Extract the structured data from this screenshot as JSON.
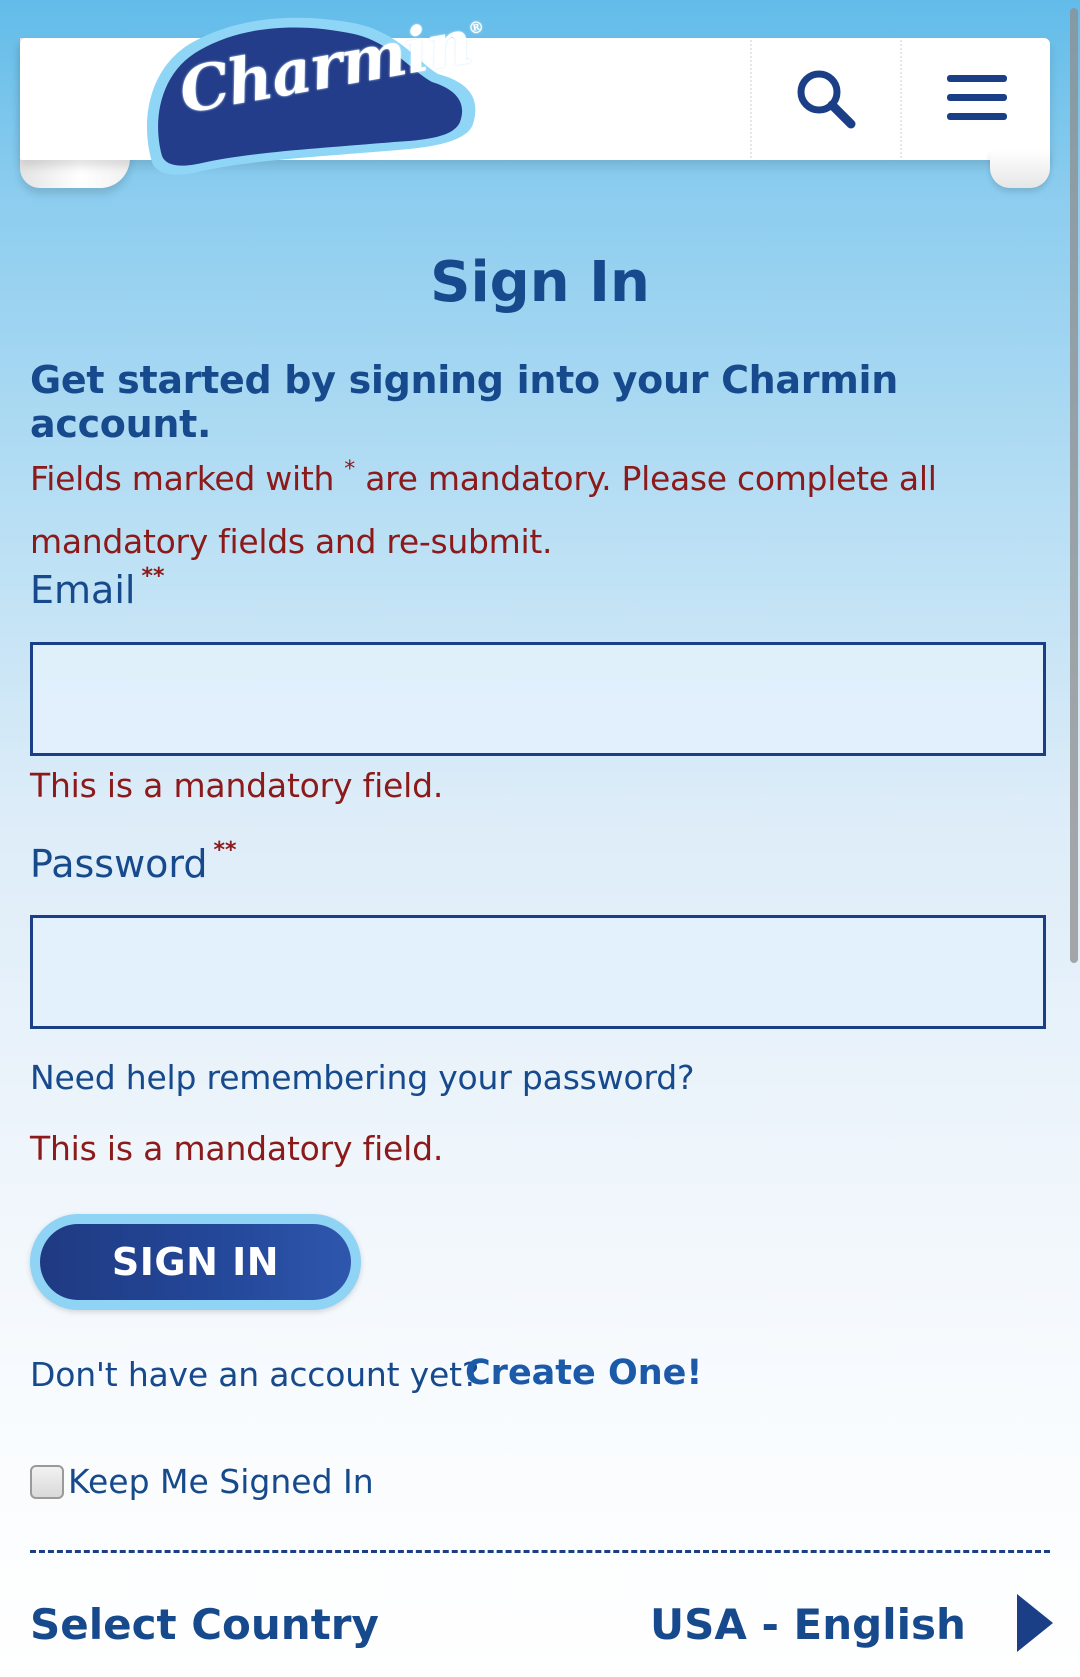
{
  "brand": {
    "logo_text": "Charmin",
    "logo_registered": "®",
    "primary_color": "#174a8c",
    "error_color": "#8c1a1a",
    "button_color": "#1f3a82"
  },
  "header": {
    "search_icon": "search-icon",
    "menu_icon": "hamburger-menu-icon"
  },
  "page": {
    "title": "Sign In",
    "subtitle": "Get started by signing into your Charmin account.",
    "notice_part1": "Fields marked with",
    "notice_asterisk": "*",
    "notice_part2": "are mandatory. Please complete all mandatory fields and re-submit."
  },
  "form": {
    "email_label": "Email",
    "email_required_mark": "**",
    "email_value": "",
    "email_error": "This is a mandatory field.",
    "password_label": "Password",
    "password_required_mark": "**",
    "password_value": "",
    "password_help": "Need help remembering your  password?",
    "password_error": "This is a mandatory field.",
    "submit_label": "SIGN IN",
    "no_account_text": "Don't have an account yet?",
    "create_link": "Create One!",
    "keep_signed_in_label": "Keep Me Signed In",
    "keep_signed_in_checked": false
  },
  "footer": {
    "select_country_label": "Select Country",
    "country_value": "USA - English",
    "arrow_icon": "triangle-right-icon"
  }
}
